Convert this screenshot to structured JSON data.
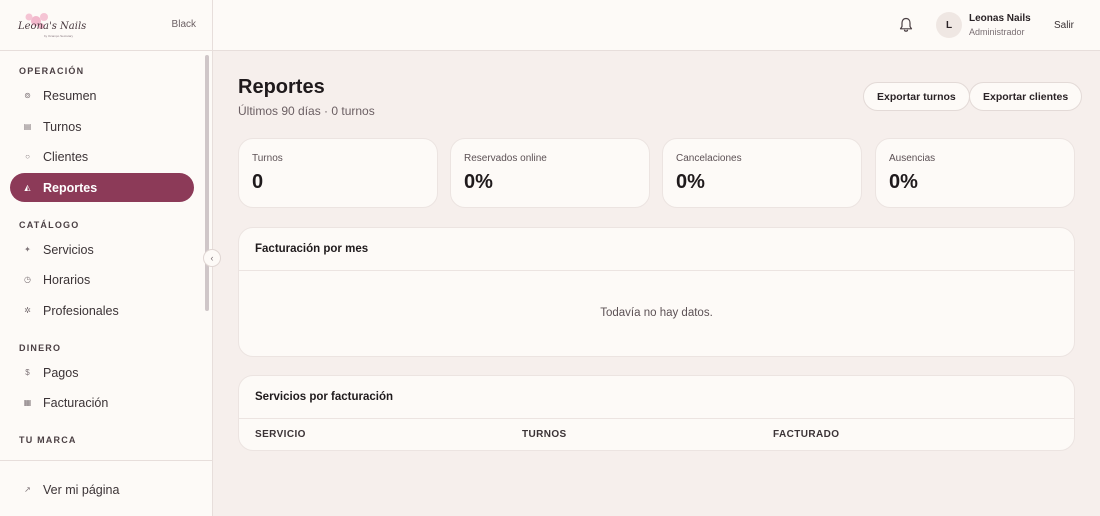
{
  "brand": {
    "logo_text": "Leona's Nails",
    "logo_subtitle": "by Ocampo Secretary",
    "badge": "Black"
  },
  "sidebar": {
    "sections": [
      {
        "label": "OPERACIÓN"
      },
      {
        "label": "CATÁLOGO"
      },
      {
        "label": "DINERO"
      },
      {
        "label": "TU MARCA"
      }
    ],
    "items": [
      {
        "label": "Resumen",
        "icon": "⊚"
      },
      {
        "label": "Turnos",
        "icon": "▤"
      },
      {
        "label": "Clientes",
        "icon": "○"
      },
      {
        "label": "Reportes",
        "icon": "◭"
      },
      {
        "label": "Servicios",
        "icon": "✦"
      },
      {
        "label": "Horarios",
        "icon": "◷"
      },
      {
        "label": "Profesionales",
        "icon": "✲"
      },
      {
        "label": "Pagos",
        "icon": "$"
      },
      {
        "label": "Facturación",
        "icon": "▦"
      }
    ],
    "bottom_item": {
      "label": "Ver mi página",
      "icon": "↗"
    },
    "collapse_glyph": "‹"
  },
  "topbar": {
    "avatar_initial": "L",
    "user_name": "Leonas Nails",
    "user_role": "Administrador",
    "logout_label": "Salir"
  },
  "main": {
    "title": "Reportes",
    "subtitle": "Últimos 90 días · 0 turnos",
    "export_turnos": "Exportar turnos",
    "export_clientes": "Exportar clientes",
    "stats": [
      {
        "label": "Turnos",
        "value": "0"
      },
      {
        "label": "Reservados online",
        "value": "0%"
      },
      {
        "label": "Cancelaciones",
        "value": "0%"
      },
      {
        "label": "Ausencias",
        "value": "0%"
      }
    ],
    "billing_card": {
      "title": "Facturación por mes",
      "empty": "Todavía no hay datos."
    },
    "services_card": {
      "title": "Servicios por facturación",
      "columns": [
        "SERVICIO",
        "TURNOS",
        "FACTURADO"
      ]
    }
  },
  "colors": {
    "accent": "#8c3a58",
    "background": "#f6efec",
    "surface": "#fdfaf7"
  }
}
